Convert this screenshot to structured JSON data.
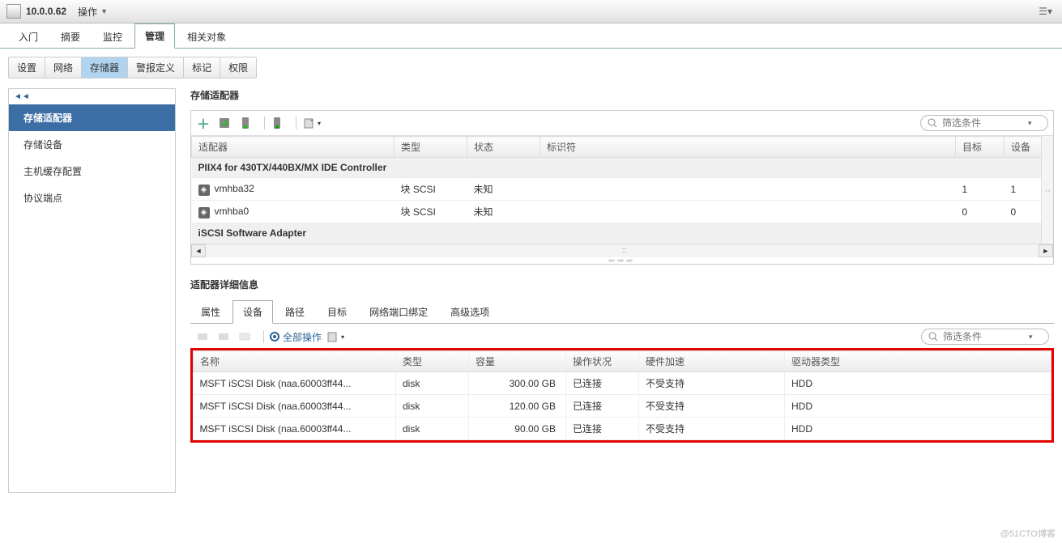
{
  "topbar": {
    "host": "10.0.0.62",
    "actions": "操作"
  },
  "navTabs": [
    {
      "label": "入门",
      "active": false
    },
    {
      "label": "摘要",
      "active": false
    },
    {
      "label": "监控",
      "active": false
    },
    {
      "label": "管理",
      "active": true
    },
    {
      "label": "相关对象",
      "active": false
    }
  ],
  "subTabs": [
    {
      "label": "设置",
      "active": false
    },
    {
      "label": "网络",
      "active": false
    },
    {
      "label": "存储器",
      "active": true
    },
    {
      "label": "警报定义",
      "active": false
    },
    {
      "label": "标记",
      "active": false
    },
    {
      "label": "权限",
      "active": false
    }
  ],
  "sidebar": {
    "items": [
      {
        "label": "存储适配器",
        "active": true
      },
      {
        "label": "存储设备",
        "active": false
      },
      {
        "label": "主机缓存配置",
        "active": false
      },
      {
        "label": "协议端点",
        "active": false
      }
    ]
  },
  "adaptersSection": {
    "title": "存储适配器",
    "filterPlaceholder": "筛选条件",
    "columns": {
      "adapter": "适配器",
      "type": "类型",
      "status": "状态",
      "id": "标识符",
      "targets": "目标",
      "devices": "设备"
    },
    "group1": "PIIX4 for 430TX/440BX/MX IDE Controller",
    "rows": [
      {
        "adapter": "vmhba32",
        "type": "块 SCSI",
        "status": "未知",
        "id": "",
        "targets": "1",
        "devices": "1"
      },
      {
        "adapter": "vmhba0",
        "type": "块 SCSI",
        "status": "未知",
        "id": "",
        "targets": "0",
        "devices": "0"
      }
    ],
    "group2": "iSCSI Software Adapter"
  },
  "detailsSection": {
    "title": "适配器详细信息",
    "tabs": [
      {
        "label": "属性",
        "active": false
      },
      {
        "label": "设备",
        "active": true
      },
      {
        "label": "路径",
        "active": false
      },
      {
        "label": "目标",
        "active": false
      },
      {
        "label": "网络端口绑定",
        "active": false
      },
      {
        "label": "高级选项",
        "active": false
      }
    ],
    "allActions": "全部操作",
    "filterPlaceholder": "筛选条件",
    "columns": {
      "name": "名称",
      "type": "类型",
      "capacity": "容量",
      "opStatus": "操作状况",
      "hwAccel": "硬件加速",
      "driveType": "驱动器类型"
    },
    "rows": [
      {
        "name": "MSFT iSCSI Disk (naa.60003ff44...",
        "type": "disk",
        "capacity": "300.00 GB",
        "opStatus": "已连接",
        "hwAccel": "不受支持",
        "driveType": "HDD"
      },
      {
        "name": "MSFT iSCSI Disk (naa.60003ff44...",
        "type": "disk",
        "capacity": "120.00 GB",
        "opStatus": "已连接",
        "hwAccel": "不受支持",
        "driveType": "HDD"
      },
      {
        "name": "MSFT iSCSI Disk (naa.60003ff44...",
        "type": "disk",
        "capacity": "90.00 GB",
        "opStatus": "已连接",
        "hwAccel": "不受支持",
        "driveType": "HDD"
      }
    ]
  },
  "watermark": "@51CTO博客"
}
